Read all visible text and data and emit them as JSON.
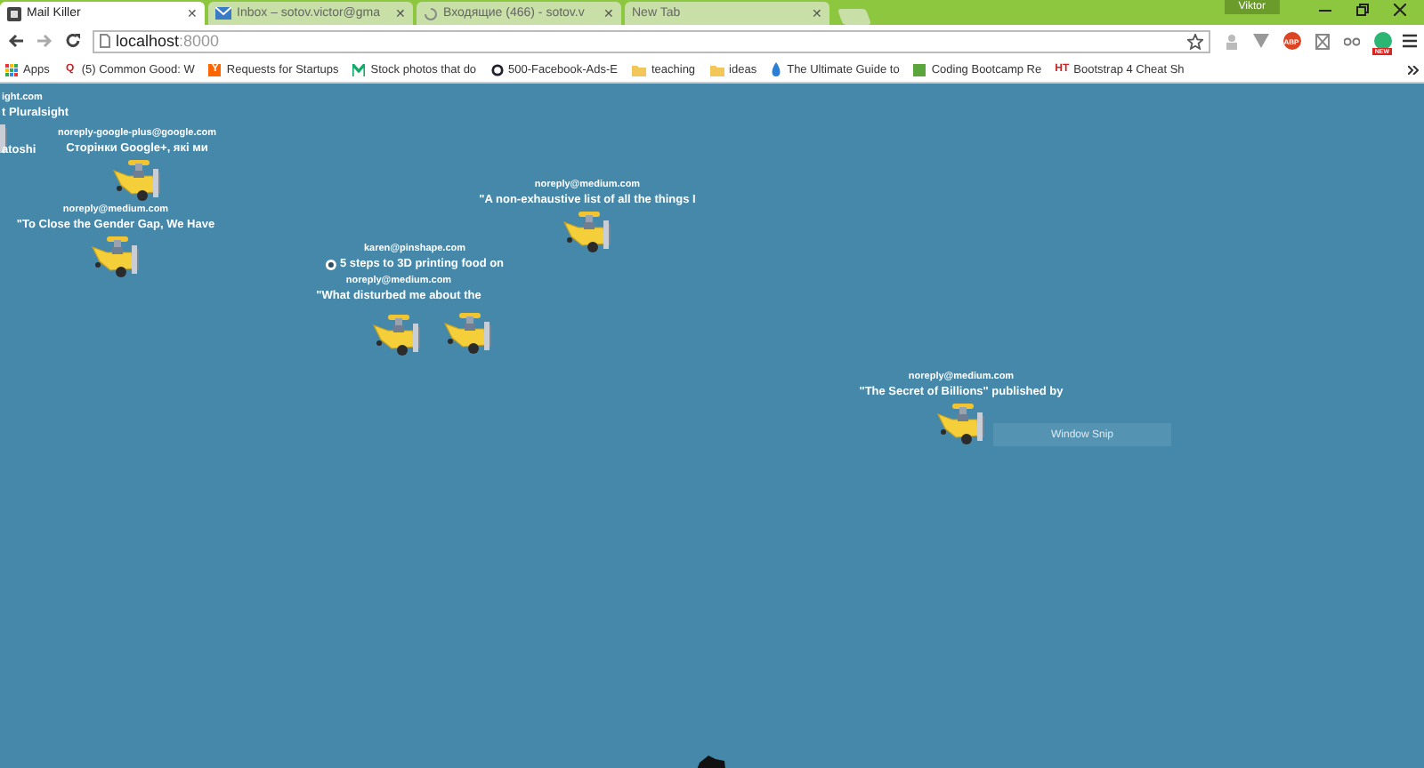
{
  "tabs": [
    {
      "title": "Mail Killer",
      "selected": true,
      "close": "✕"
    },
    {
      "title": "Inbox – sotov.victor@gma",
      "selected": false,
      "close": "✕"
    },
    {
      "title": "Входящие (466) - sotov.v",
      "selected": false,
      "close": "✕"
    },
    {
      "title": "New Tab",
      "selected": false,
      "close": "✕"
    }
  ],
  "profile": "Viktor",
  "address": {
    "host": "localhost",
    "port": ":8000"
  },
  "extensions": [
    {
      "kind": "person"
    },
    {
      "kind": "filter"
    },
    {
      "kind": "adblock",
      "badge": "ABP"
    },
    {
      "kind": "box"
    },
    {
      "kind": "glasses"
    },
    {
      "kind": "grammar",
      "badge": "NEW"
    }
  ],
  "bookmarks": [
    {
      "label": "Apps"
    },
    {
      "label": "(5) Common Good: W",
      "badge": "Q"
    },
    {
      "label": "Requests for Startups",
      "badge": "Y"
    },
    {
      "label": "Stock photos that do"
    },
    {
      "label": "500-Facebook-Ads-E"
    },
    {
      "label": "teaching"
    },
    {
      "label": "ideas"
    },
    {
      "label": "The Ultimate Guide to"
    },
    {
      "label": "Coding Bootcamp Re"
    },
    {
      "label": "Bootstrap 4 Cheat Sh",
      "badge": "HT"
    }
  ],
  "emails": [
    {
      "sender": "ight.com",
      "subject": "t Pluralsight"
    },
    {
      "subject": "atoshi"
    },
    {
      "sender": "noreply-google-plus@google.com",
      "subject": "Сторінки Google+, які ми"
    },
    {
      "sender": "noreply@medium.com",
      "subject": "\"To Close the Gender Gap, We Have"
    },
    {
      "sender": "noreply@medium.com",
      "subject": "\"A non-exhaustive list of all the things I"
    },
    {
      "sender": "karen@pinshape.com",
      "subject": "5 steps to 3D printing food on",
      "icon": true
    },
    {
      "sender": "noreply@medium.com",
      "subject": "\"What disturbed me about the"
    },
    {
      "sender": "noreply@medium.com",
      "subject": "\"The Secret of Billions\" published by"
    }
  ],
  "tooltip": "Window Snip"
}
